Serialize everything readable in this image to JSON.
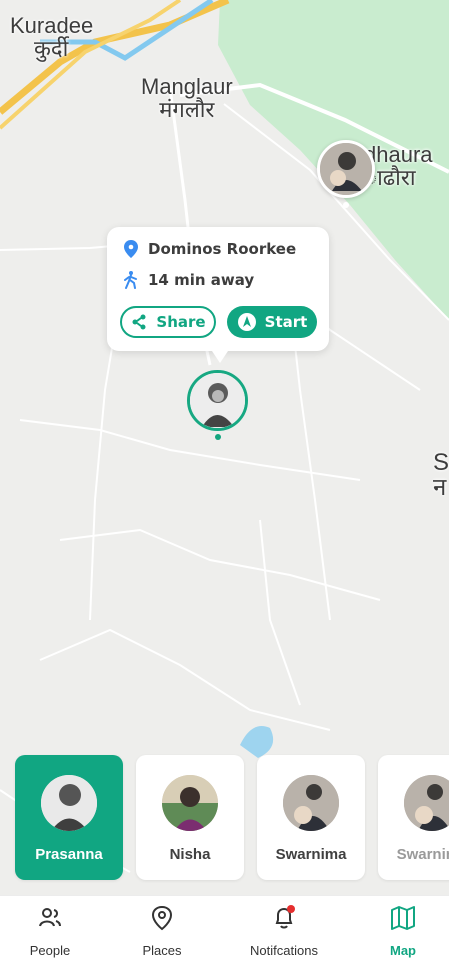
{
  "map": {
    "places": [
      {
        "name": "Kuradee",
        "native": "कुर्दी"
      },
      {
        "name": "Manglaur",
        "native": "मंगलौर"
      },
      {
        "name": "dhaura",
        "native": "ाढौरा"
      },
      {
        "name": "S",
        "native": "न"
      }
    ]
  },
  "popup": {
    "location": "Dominos Roorkee",
    "eta": "14 min away",
    "share_label": "Share",
    "start_label": "Start"
  },
  "cards": [
    {
      "name": "Prasanna",
      "active": true
    },
    {
      "name": "Nisha",
      "active": false
    },
    {
      "name": "Swarnima",
      "active": false
    },
    {
      "name": "Swarnima",
      "active": false
    }
  ],
  "nav": [
    {
      "label": "People",
      "icon": "people-icon",
      "active": false
    },
    {
      "label": "Places",
      "icon": "place-pin-icon",
      "active": false
    },
    {
      "label": "Notifcations",
      "icon": "bell-icon",
      "active": false
    },
    {
      "label": "Map",
      "icon": "map-icon",
      "active": true
    }
  ],
  "colors": {
    "accent": "#11a682",
    "notification": "#e52e2e",
    "park": "#c9eccf",
    "map_bg": "#eeeeec"
  }
}
